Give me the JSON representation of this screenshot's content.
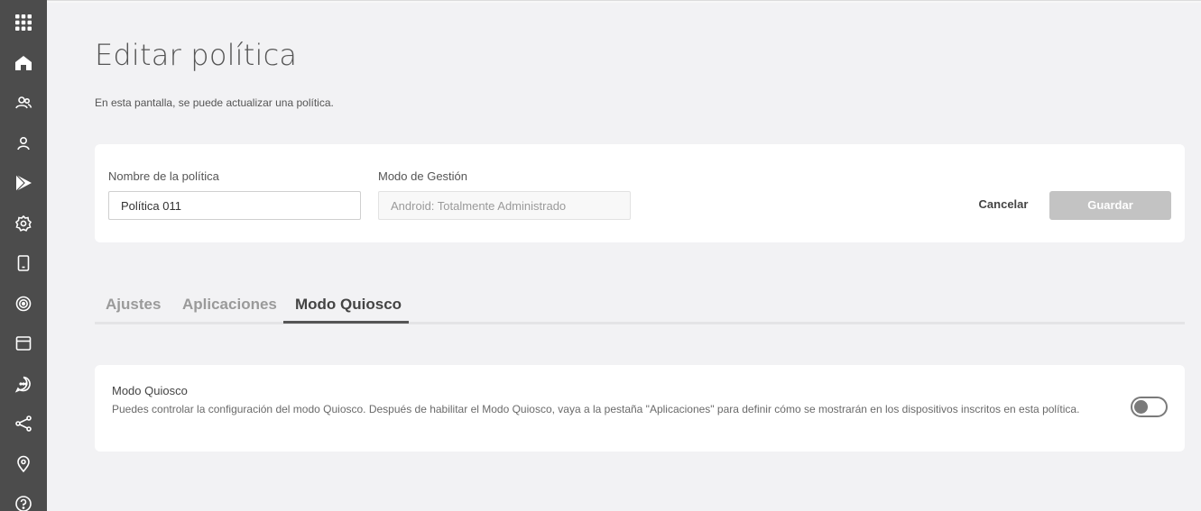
{
  "sidebar": {
    "items": [
      {
        "icon": "apps-grid-icon"
      },
      {
        "icon": "home-icon"
      },
      {
        "icon": "users-icon"
      },
      {
        "icon": "user-icon"
      },
      {
        "icon": "play-store-icon"
      },
      {
        "icon": "settings-icon"
      },
      {
        "icon": "device-icon"
      },
      {
        "icon": "target-icon"
      },
      {
        "icon": "browser-window-icon"
      },
      {
        "icon": "chat-icon"
      },
      {
        "icon": "share-icon"
      },
      {
        "icon": "location-icon"
      },
      {
        "icon": "help-icon"
      }
    ]
  },
  "page": {
    "title": "Editar política",
    "subtitle": "En esta pantalla, se puede actualizar una política."
  },
  "form": {
    "name_label": "Nombre de la política",
    "name_value": "Política 011",
    "mode_label": "Modo de Gestión",
    "mode_placeholder": "Android: Totalmente Administrado",
    "cancel_label": "Cancelar",
    "save_label": "Guardar"
  },
  "tabs": [
    {
      "label": "Ajustes",
      "active": false
    },
    {
      "label": "Aplicaciones",
      "active": false
    },
    {
      "label": "Modo Quiosco",
      "active": true
    }
  ],
  "kiosk": {
    "title": "Modo Quiosco",
    "description": "Puedes controlar la configuración del modo Quiosco. Después de habilitar el Modo Quiosco, vaya a la pestaña \"Aplicaciones\" para definir cómo se mostrarán en los dispositivos inscritos en esta política.",
    "enabled": false
  },
  "colors": {
    "sidebar_bg": "#4c4c4c",
    "page_bg": "#f2f2f4",
    "save_disabled": "#c3c3c3"
  }
}
